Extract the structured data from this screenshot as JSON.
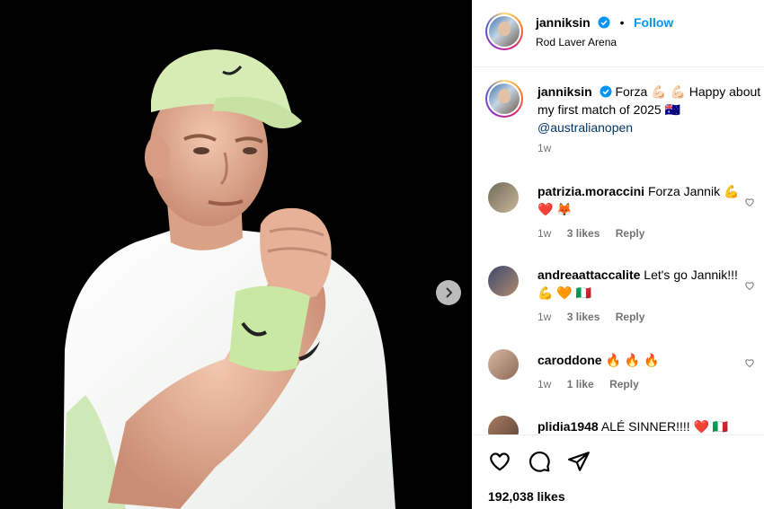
{
  "post": {
    "username": "janniksin",
    "follow_label": "Follow",
    "location": "Rod Laver Arena",
    "likes": "192,038 likes"
  },
  "caption": {
    "username": "janniksin",
    "line1": "Forza 💪🏻 💪🏻  Happy about",
    "line2": "my first match of 2025 🇦🇺",
    "mention": "@australianopen",
    "time": "1w"
  },
  "comments": [
    {
      "username": "patrizia.moraccini",
      "text": "Forza Jannik 💪",
      "text2": "❤️ 🦊",
      "time": "1w",
      "likes": "3 likes",
      "reply": "Reply"
    },
    {
      "username": "andreaattaccalite",
      "text": "Let's go Jannik!!!",
      "text2": "💪 🧡 🇮🇹",
      "time": "1w",
      "likes": "3 likes",
      "reply": "Reply"
    },
    {
      "username": "caroddone",
      "text": "🔥 🔥 🔥",
      "time": "1w",
      "likes": "1 like",
      "reply": "Reply"
    },
    {
      "username": "plidia1948",
      "text": "ALÉ SINNER!!!! ❤️ 🇮🇹"
    }
  ],
  "icons": {
    "like": "heart-icon",
    "comment": "comment-icon",
    "share": "share-icon",
    "next": "chevron-right-icon",
    "verified": "verified-badge-icon"
  },
  "colors": {
    "follow": "#0095f6",
    "verified": "#0095f6",
    "wristband": "#c9e8a4",
    "cap": "#d6ecb4"
  }
}
